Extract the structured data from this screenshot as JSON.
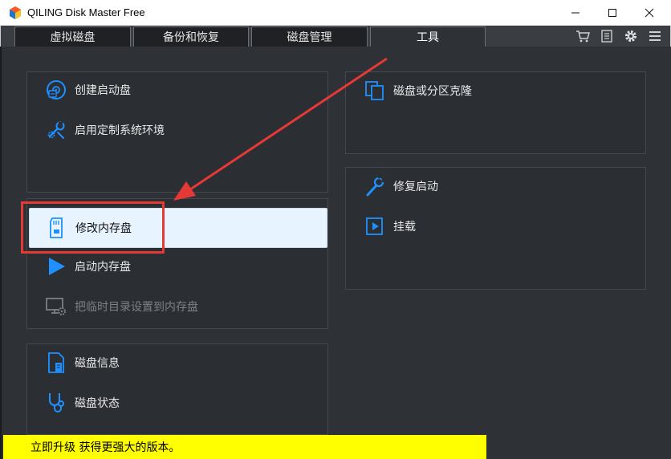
{
  "window": {
    "title": "QILING Disk Master Free"
  },
  "tabs": [
    {
      "label": "虚拟磁盘"
    },
    {
      "label": "备份和恢复"
    },
    {
      "label": "磁盘管理"
    },
    {
      "label": "工具",
      "active": true
    }
  ],
  "toolbar_icons": [
    "cart-icon",
    "list-icon",
    "gear-icon",
    "menu-icon"
  ],
  "panels": {
    "boot": {
      "items": [
        {
          "label": "创建启动盘",
          "icon": "boot-disc-icon"
        },
        {
          "label": "启用定制系统环境",
          "icon": "tools-icon"
        }
      ]
    },
    "ramdisk": {
      "items": [
        {
          "label": "修改内存盘",
          "icon": "sd-card-icon",
          "selected": true
        },
        {
          "label": "启动内存盘",
          "icon": "play-icon"
        },
        {
          "label": "把临时目录设置到内存盘",
          "icon": "monitor-gear-icon",
          "disabled": true
        }
      ]
    },
    "diskinfo": {
      "items": [
        {
          "label": "磁盘信息",
          "icon": "document-icon"
        },
        {
          "label": "磁盘状态",
          "icon": "stethoscope-icon"
        }
      ]
    },
    "clone": {
      "items": [
        {
          "label": "磁盘或分区克隆",
          "icon": "clone-icon"
        }
      ]
    },
    "repair": {
      "items": [
        {
          "label": "修复启动",
          "icon": "wrench-icon"
        },
        {
          "label": "挂载",
          "icon": "mount-icon"
        }
      ]
    }
  },
  "banner": {
    "text": "立即升级 获得更强大的版本。"
  },
  "colors": {
    "accent": "#1e90ff",
    "background": "#2e3136",
    "annotation": "#e53935",
    "banner": "#ffff00"
  }
}
